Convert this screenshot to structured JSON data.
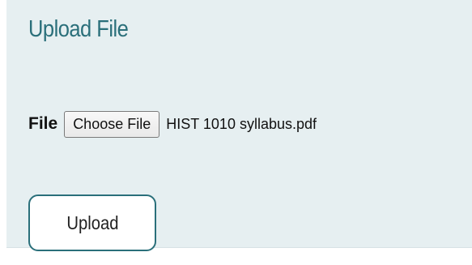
{
  "form": {
    "title": "Upload File",
    "file_label": "File",
    "choose_button_label": "Choose File",
    "selected_file_name": "HIST 1010 syllabus.pdf",
    "upload_button_label": "Upload"
  },
  "colors": {
    "accent": "#2a6f7a",
    "panel_background": "#e6eff1"
  }
}
